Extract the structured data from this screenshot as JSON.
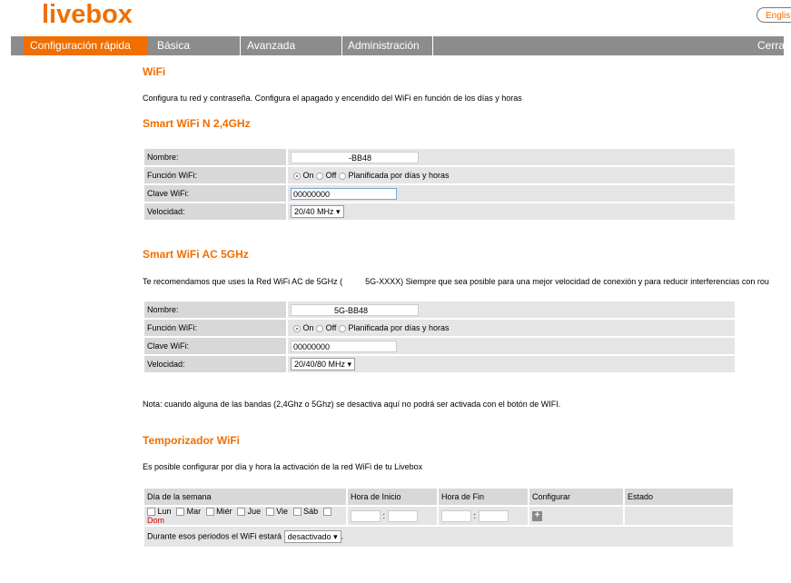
{
  "header": {
    "logo": "livebox",
    "lang_button": "English"
  },
  "nav": {
    "items": [
      "Configuración rápida",
      "Básica",
      "Avanzada",
      "Administración"
    ],
    "logout": "Cerrar"
  },
  "wifi": {
    "title": "WiFi",
    "description": "Configura tu red y contraseña. Configura el apagado y encendido del WiFi en función de los días y horas"
  },
  "band24": {
    "title": "Smart WiFi N 2,4GHz",
    "name_label": "Nombre:",
    "name_value": "-BB48",
    "function_label": "Función WiFi:",
    "opt_on": "On",
    "opt_off": "Off",
    "opt_planned": "Planificada por días y horas",
    "selected": "On",
    "key_label": "Clave WiFi:",
    "key_value": "00000000",
    "speed_label": "Velocidad:",
    "speed_value": "20/40 MHz"
  },
  "band5": {
    "title": "Smart WiFi AC 5GHz",
    "recommend_part1": "Te recomendamos que uses la Red WiFi AC de 5GHz (",
    "recommend_part2": "5G-XXXX) Siempre que sea posible para una mejor velocidad de conexión y para reducir interferencias con rou",
    "name_label": "Nombre:",
    "name_value": "5G-BB48",
    "function_label": "Función WiFi:",
    "opt_on": "On",
    "opt_off": "Off",
    "opt_planned": "Planificada por días y horas",
    "selected": "On",
    "key_label": "Clave WiFi:",
    "key_value": "00000000",
    "speed_label": "Velocidad:",
    "speed_value": "20/40/80 MHz"
  },
  "note": "Nota: cuando alguna de las bandas (2,4Ghz o 5Ghz) se desactiva aquí no podrá ser activada con el botón de WIFI.",
  "timer": {
    "title": "Temporizador WiFi",
    "description": "Es posible configurar por día y hora la activación de la red WiFi de tu Livebox",
    "col_days": "Día de la semana",
    "col_start": "Hora de Inicio",
    "col_end": "Hora de Fin",
    "col_config": "Configurar",
    "col_status": "Estado",
    "days": [
      "Lun",
      "Mar",
      "Miér",
      "Jue",
      "Vie",
      "Sáb",
      "Dom"
    ],
    "time_sep": ":",
    "plus": "+",
    "during_label": "Durante esos periodos el WiFi estará",
    "during_value": "desactivado",
    "during_end": "."
  },
  "colors": {
    "accent": "#f16e00",
    "nav_bg": "#8c8c8c",
    "row_bg": "#e5e5e5",
    "label_bg": "#d8d8d8",
    "sunday": "#d00000"
  }
}
